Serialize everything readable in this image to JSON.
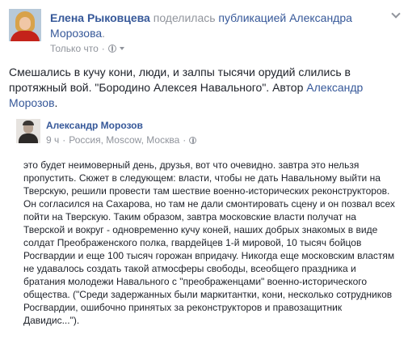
{
  "header": {
    "author": "Елена Рыковцева",
    "action": "поделилась",
    "publication_label": "публикацией Александра Морозова",
    "time": "Только что",
    "separator": "·"
  },
  "message": {
    "text": "Смешались в кучу кони, люди, и залпы тысячи орудий слились в протяжный вой. \"Бородино Алексея Навального\". Автор ",
    "author_link": "Александр Морозов",
    "end": "."
  },
  "shared": {
    "author": "Александр Морозов",
    "time": "9 ч",
    "separator": "·",
    "location": "Россия, Moscow, Москва",
    "text": "это будет неимоверный день, друзья, вот что очевидно. завтра это нельзя пропустить. Сюжет в следующем: власти, чтобы не дать Навальному выйти на Тверскую, решили провести там шествие военно-исторических реконструкторов. Он согласился на Сахарова, но там не дали смонтировать сцену и он позвал всех пойти на Тверскую. Таким образом, завтра московские власти получат на Тверской и вокруг - одновременно кучу коней, наших добрых знакомых в виде солдат Преображенского полка, гвардейцев 1-й мировой, 10 тысяч бойцов Росгвардии и еще 100 тысяч горожан впридачу. Никогда еще московским властям не удавалось создать такой атмосферы свободы, всеобщего праздника и братания молодежи Навального с \"преображенцами\" военно-исторического общества. (\"Среди задержанных были маркитантки, кони, несколько сотрудников Росгвардии, ошибочно принятых за реконструкторов и правозащитник Давидис...\")."
  },
  "icons": {
    "avatar": "avatar-photo",
    "globe": "globe-icon",
    "menu": "chevron-down-icon"
  }
}
